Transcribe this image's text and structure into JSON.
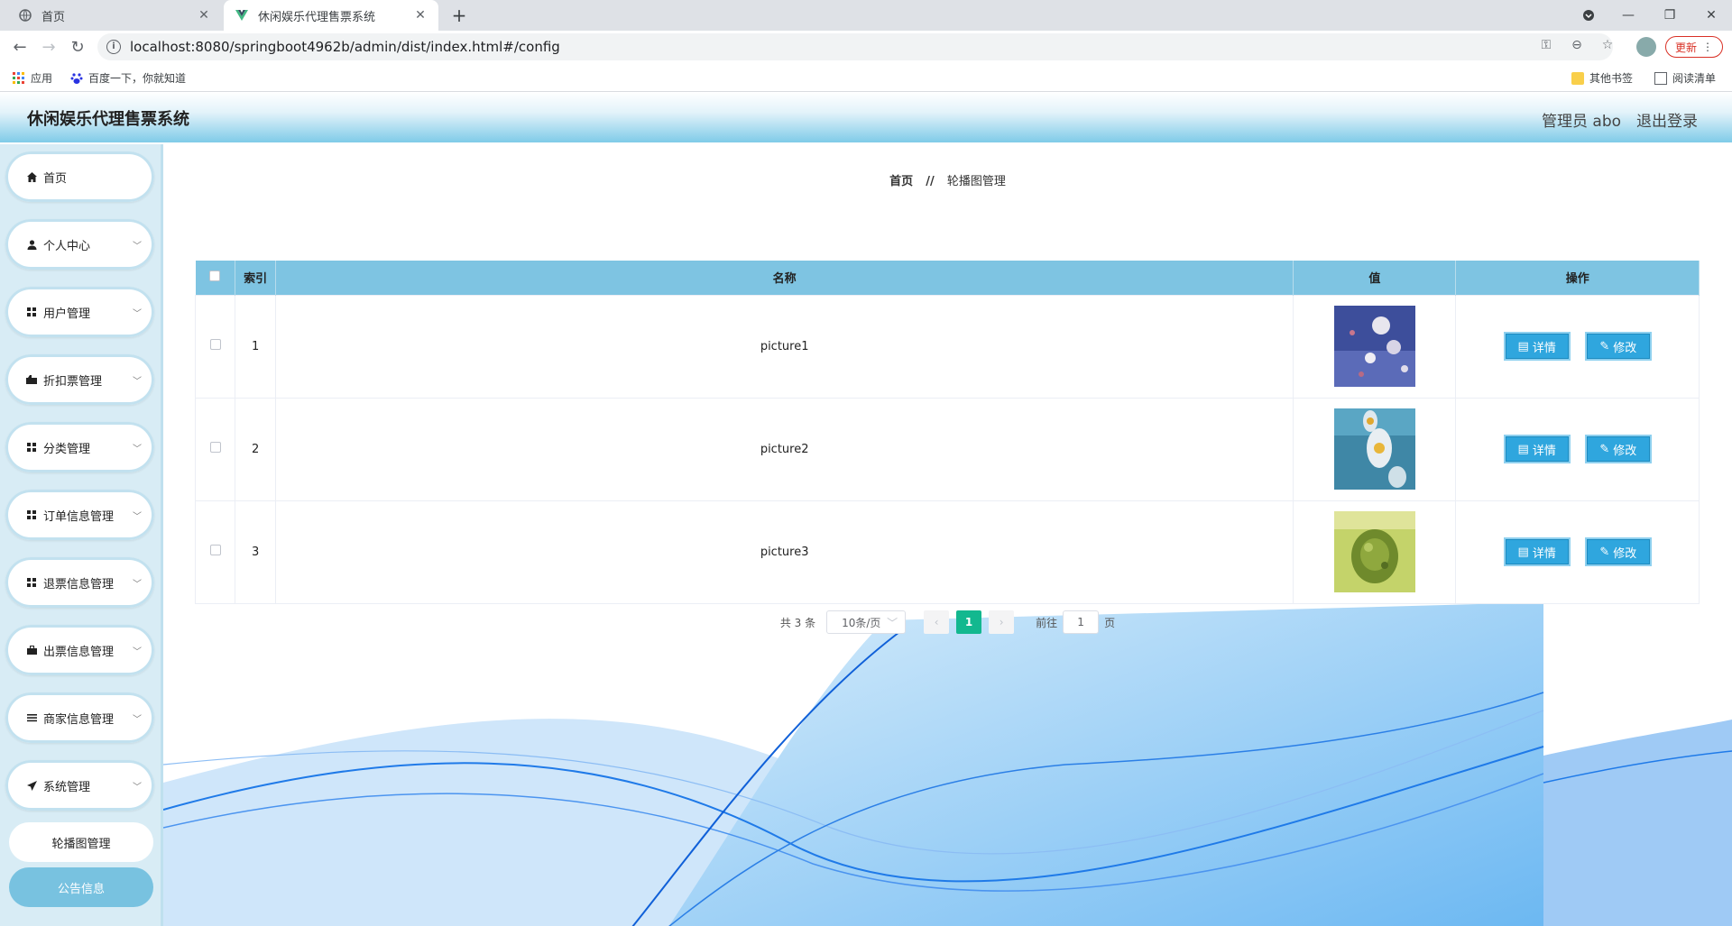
{
  "browser": {
    "tabs": [
      {
        "title": "首页"
      },
      {
        "title": "休闲娱乐代理售票系统"
      }
    ],
    "url": "localhost:8080/springboot4962b/admin/dist/index.html#/config",
    "update_label": "更新",
    "bookmarks": {
      "apps": "应用",
      "baidu": "百度一下，你就知道",
      "other": "其他书签",
      "reading": "阅读清单"
    }
  },
  "header": {
    "title": "休闲娱乐代理售票系统",
    "user": "管理员 abo",
    "logout": "退出登录"
  },
  "sidebar": {
    "items": [
      {
        "label": "首页",
        "icon": "home-icon"
      },
      {
        "label": "个人中心",
        "icon": "user-icon"
      },
      {
        "label": "用户管理",
        "icon": "grid-icon"
      },
      {
        "label": "折扣票管理",
        "icon": "ticket-icon"
      },
      {
        "label": "分类管理",
        "icon": "grid-icon"
      },
      {
        "label": "订单信息管理",
        "icon": "grid-icon"
      },
      {
        "label": "退票信息管理",
        "icon": "grid-icon"
      },
      {
        "label": "出票信息管理",
        "icon": "briefcase-icon"
      },
      {
        "label": "商家信息管理",
        "icon": "list-icon"
      },
      {
        "label": "系统管理",
        "icon": "send-icon"
      }
    ],
    "subitems": [
      {
        "label": "轮播图管理"
      },
      {
        "label": "公告信息"
      }
    ]
  },
  "breadcrumb": {
    "home": "首页",
    "separator": "//",
    "current": "轮播图管理"
  },
  "table": {
    "columns": [
      "索引",
      "名称",
      "值",
      "操作"
    ],
    "rows": [
      {
        "index": "1",
        "name": "picture1",
        "thumb": "flowers-blue"
      },
      {
        "index": "2",
        "name": "picture2",
        "thumb": "daisy-teal"
      },
      {
        "index": "3",
        "name": "picture3",
        "thumb": "green-bokeh"
      }
    ],
    "detail_label": "详情",
    "edit_label": "修改"
  },
  "pagination": {
    "total": "共 3 条",
    "page_size": "10条/页",
    "current_page": "1",
    "goto_label": "前往",
    "goto_value": "1",
    "page_suffix": "页"
  },
  "colors": {
    "header_accent": "#7fcbe8",
    "table_header": "#7ec4e2",
    "button": "#2fa6de",
    "active_page": "#13b88f",
    "active_sidebar": "#78c2e0"
  }
}
